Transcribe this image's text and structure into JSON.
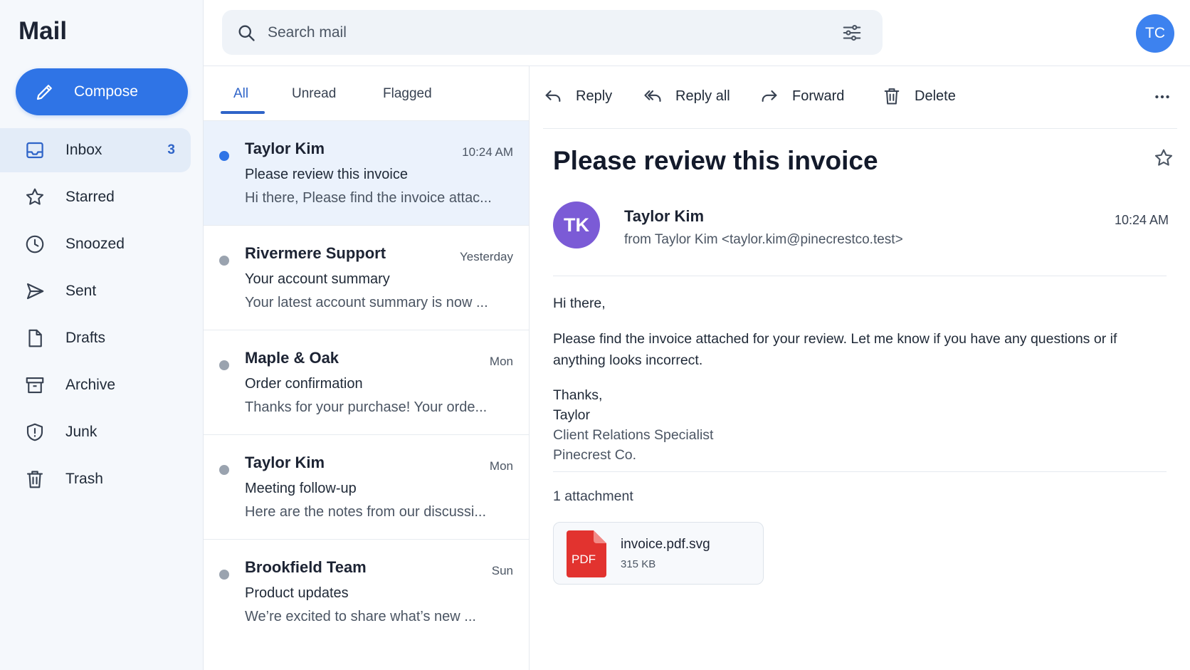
{
  "app": {
    "title": "Mail"
  },
  "sidebar": {
    "compose_label": "Compose",
    "items": [
      {
        "label": "Inbox",
        "icon": "inbox-icon",
        "badge": "3",
        "active": true
      },
      {
        "label": "Starred",
        "icon": "star-icon"
      },
      {
        "label": "Snoozed",
        "icon": "clock-icon"
      },
      {
        "label": "Sent",
        "icon": "send-icon"
      },
      {
        "label": "Drafts",
        "icon": "draft-icon"
      },
      {
        "label": "Archive",
        "icon": "archive-icon"
      },
      {
        "label": "Junk",
        "icon": "shield-icon"
      },
      {
        "label": "Trash",
        "icon": "trash-icon"
      }
    ]
  },
  "search": {
    "placeholder": "Search mail"
  },
  "user": {
    "initials": "TC"
  },
  "list": {
    "tabs": [
      {
        "label": "All",
        "active": true
      },
      {
        "label": "Unread"
      },
      {
        "label": "Flagged"
      }
    ],
    "messages": [
      {
        "from": "Taylor Kim",
        "time": "10:24 AM",
        "subject": "Please review this invoice",
        "preview": "Hi there, Please find the invoice attac...",
        "unread": true,
        "selected": true
      },
      {
        "from": "Rivermere Support",
        "time": "Yesterday",
        "subject": "Your account summary",
        "preview": "Your latest account summary is now ..."
      },
      {
        "from": "Maple & Oak",
        "time": "Mon",
        "subject": "Order confirmation",
        "preview": "Thanks for your purchase! Your orde..."
      },
      {
        "from": "Taylor Kim",
        "time": "Mon",
        "subject": "Meeting follow-up",
        "preview": "Here are the notes from our discussi..."
      },
      {
        "from": "Brookfield Team",
        "time": "Sun",
        "subject": "Product updates",
        "preview": "We’re excited to share what’s new ..."
      }
    ]
  },
  "reader": {
    "actions": {
      "reply": "Reply",
      "reply_all": "Reply all",
      "forward": "Forward",
      "delete": "Delete"
    },
    "subject": "Please review this invoice",
    "sender": {
      "initials": "TK",
      "name": "Taylor Kim",
      "from_line": "from Taylor Kim <taylor.kim@pinecrestco.test>",
      "time": "10:24 AM"
    },
    "body": {
      "greeting": "Hi there,",
      "paragraph": "Please find the invoice attached for your review. Let me know if you have any questions or if anything looks incorrect.",
      "signoff": "Thanks,",
      "signature_name": "Taylor",
      "signature_title": "Client Relations Specialist",
      "signature_company": "Pinecrest Co."
    },
    "attachments_label": "1 attachment",
    "attachment": {
      "name": "invoice.pdf.svg",
      "size": "315 KB",
      "badge": "PDF"
    }
  },
  "colors": {
    "accent": "#2f74e6",
    "unread_dot": "#2f74e6",
    "pdf": "#e2332f",
    "sender_avatar": "#7b5bd6"
  }
}
